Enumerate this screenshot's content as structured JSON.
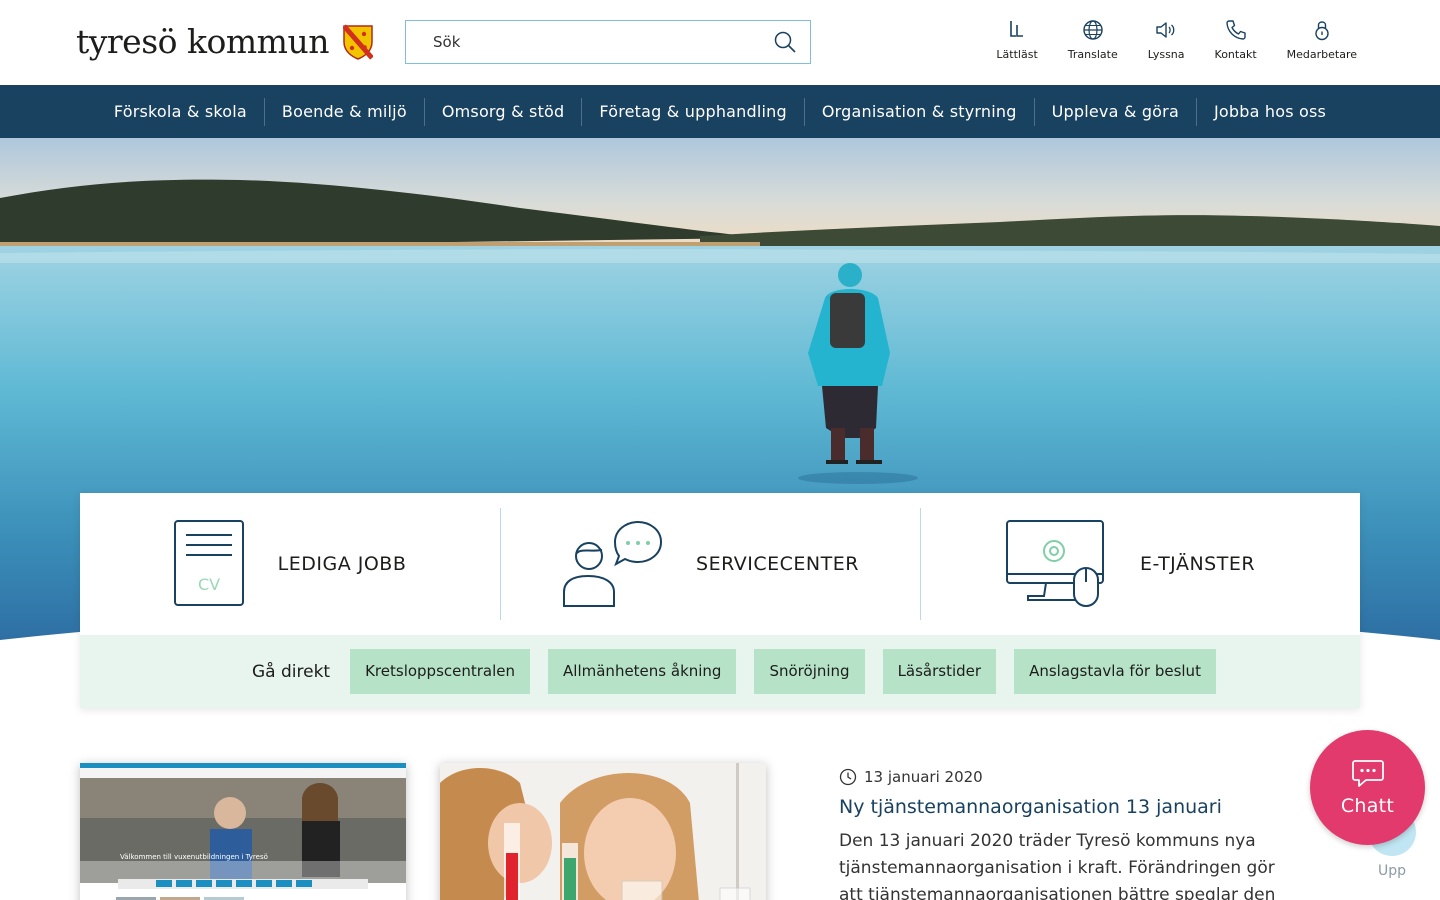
{
  "header": {
    "logo_text": "tyresö kommun",
    "search_placeholder": "Sök",
    "tools": [
      {
        "label": "Lättläst",
        "icon": "easy-read-icon"
      },
      {
        "label": "Translate",
        "icon": "globe-icon"
      },
      {
        "label": "Lyssna",
        "icon": "speaker-icon"
      },
      {
        "label": "Kontakt",
        "icon": "phone-icon"
      },
      {
        "label": "Medarbetare",
        "icon": "lock-icon"
      }
    ]
  },
  "nav": {
    "items": [
      "Förskola & skola",
      "Boende & miljö",
      "Omsorg & stöd",
      "Företag & upphandling",
      "Organisation & styrning",
      "Uppleva & göra",
      "Jobba hos oss"
    ]
  },
  "quick": {
    "cards": [
      {
        "label": "LEDIGA JOBB",
        "icon": "cv-document-icon",
        "icon_text": "CV"
      },
      {
        "label": "SERVICECENTER",
        "icon": "person-speech-icon"
      },
      {
        "label": "E-TJÄNSTER",
        "icon": "computer-gear-icon"
      }
    ],
    "direct_label": "Gå direkt",
    "direct_links": [
      "Kretsloppscentralen",
      "Allmänhetens åkning",
      "Snöröjning",
      "Läsårstider",
      "Anslagstavla för beslut"
    ]
  },
  "news": {
    "thumb1_caption": "Välkommen till vuxenutbildningen i Tyresö",
    "article": {
      "date": "13 januari 2020",
      "title": "Ny tjänstemannaorganisation 13 januari",
      "text": "Den 13 januari 2020 träder Tyresö kommuns nya tjänstemannaorganisation i kraft. Förändringen gör att tjänstemannaorganisationen bättre speglar den politiska"
    }
  },
  "floating": {
    "chat_label": "Chatt",
    "up_label": "Upp"
  },
  "colors": {
    "nav_bg": "#194160",
    "direct_bg": "#e8f5ee",
    "direct_btn": "#b6e3c8",
    "chat_bg": "#e23a6d",
    "link": "#194160"
  }
}
